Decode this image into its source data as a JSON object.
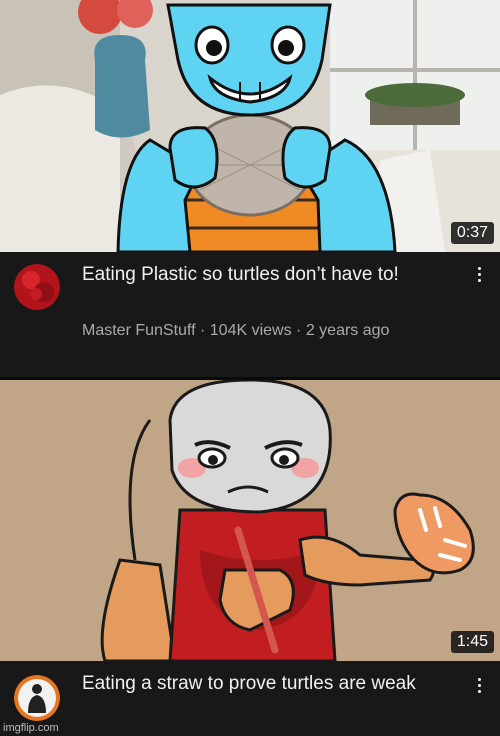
{
  "videos": [
    {
      "title": "Eating Plastic so turtles don’t have to!",
      "channel": "Master FunStuff",
      "views": "104K views",
      "age": "2 years ago",
      "separator": "·",
      "duration": "0:37",
      "avatar_color": "#b3141b"
    },
    {
      "title": "Eating a straw to prove turtles are weak",
      "duration": "1:45",
      "avatar_color": "#e8761f"
    }
  ],
  "watermark": "imgflip.com",
  "icons": {
    "more": "more-vert-icon"
  }
}
